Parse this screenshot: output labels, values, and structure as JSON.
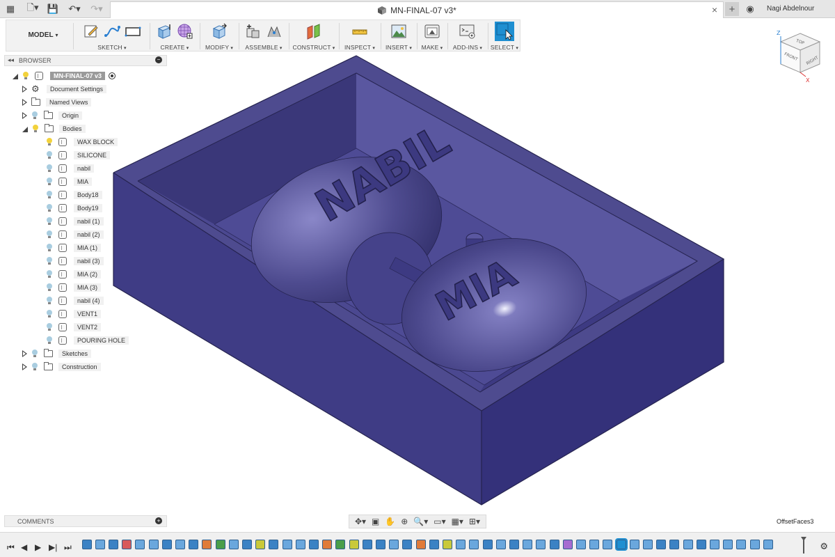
{
  "window": {
    "title": "MN-FINAL-07 v3*",
    "user": "Nagi Abdelnour"
  },
  "toolbar": {
    "workspace": "MODEL",
    "groups": [
      "SKETCH",
      "CREATE",
      "MODIFY",
      "ASSEMBLE",
      "CONSTRUCT",
      "INSPECT",
      "INSERT",
      "MAKE",
      "ADD-INS",
      "SELECT"
    ]
  },
  "browser": {
    "title": "BROWSER",
    "root": "MN-FINAL-07 v3",
    "items": {
      "document_settings": "Document Settings",
      "named_views": "Named Views",
      "origin": "Origin",
      "bodies": "Bodies",
      "sketches": "Sketches",
      "construction": "Construction"
    },
    "bodies": [
      "WAX BLOCK",
      "SILICONE",
      "nabil",
      "MIA",
      "Body18",
      "Body19",
      "nabil (1)",
      "nabil (2)",
      "MIA (1)",
      "nabil (3)",
      "MIA (2)",
      "MIA (3)",
      "nabil (4)",
      "VENT1",
      "VENT2",
      "POURING HOLE"
    ]
  },
  "comments": {
    "title": "COMMENTS"
  },
  "status": {
    "command": "OffsetFaces3"
  },
  "viewcube": {
    "top": "TOP",
    "front": "FRONT",
    "right": "RIGHT",
    "axis_z": "Z",
    "axis_x": "X"
  },
  "model_text": {
    "left": "NABIL",
    "right": "MIA"
  },
  "colors": {
    "accent": "#1f8fd1",
    "model": "#4e4b8f",
    "bulb_on": "#f2d23c",
    "bulb_off": "#a9cde0"
  }
}
